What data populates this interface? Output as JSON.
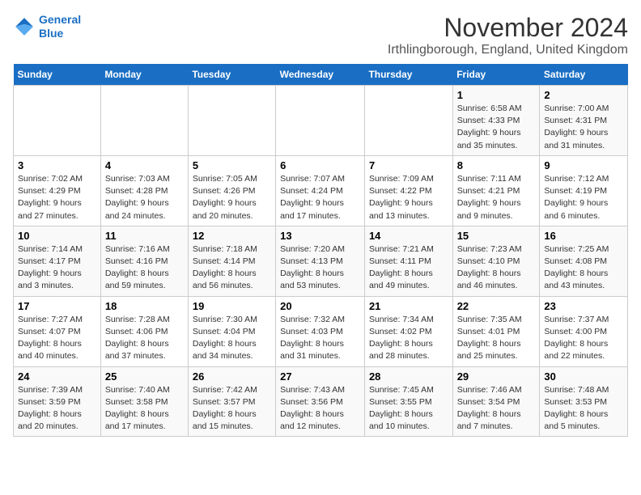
{
  "logo": {
    "line1": "General",
    "line2": "Blue"
  },
  "title": "November 2024",
  "location": "Irthlingborough, England, United Kingdom",
  "days_of_week": [
    "Sunday",
    "Monday",
    "Tuesday",
    "Wednesday",
    "Thursday",
    "Friday",
    "Saturday"
  ],
  "weeks": [
    [
      {
        "day": "",
        "info": ""
      },
      {
        "day": "",
        "info": ""
      },
      {
        "day": "",
        "info": ""
      },
      {
        "day": "",
        "info": ""
      },
      {
        "day": "",
        "info": ""
      },
      {
        "day": "1",
        "info": "Sunrise: 6:58 AM\nSunset: 4:33 PM\nDaylight: 9 hours and 35 minutes."
      },
      {
        "day": "2",
        "info": "Sunrise: 7:00 AM\nSunset: 4:31 PM\nDaylight: 9 hours and 31 minutes."
      }
    ],
    [
      {
        "day": "3",
        "info": "Sunrise: 7:02 AM\nSunset: 4:29 PM\nDaylight: 9 hours and 27 minutes."
      },
      {
        "day": "4",
        "info": "Sunrise: 7:03 AM\nSunset: 4:28 PM\nDaylight: 9 hours and 24 minutes."
      },
      {
        "day": "5",
        "info": "Sunrise: 7:05 AM\nSunset: 4:26 PM\nDaylight: 9 hours and 20 minutes."
      },
      {
        "day": "6",
        "info": "Sunrise: 7:07 AM\nSunset: 4:24 PM\nDaylight: 9 hours and 17 minutes."
      },
      {
        "day": "7",
        "info": "Sunrise: 7:09 AM\nSunset: 4:22 PM\nDaylight: 9 hours and 13 minutes."
      },
      {
        "day": "8",
        "info": "Sunrise: 7:11 AM\nSunset: 4:21 PM\nDaylight: 9 hours and 9 minutes."
      },
      {
        "day": "9",
        "info": "Sunrise: 7:12 AM\nSunset: 4:19 PM\nDaylight: 9 hours and 6 minutes."
      }
    ],
    [
      {
        "day": "10",
        "info": "Sunrise: 7:14 AM\nSunset: 4:17 PM\nDaylight: 9 hours and 3 minutes."
      },
      {
        "day": "11",
        "info": "Sunrise: 7:16 AM\nSunset: 4:16 PM\nDaylight: 8 hours and 59 minutes."
      },
      {
        "day": "12",
        "info": "Sunrise: 7:18 AM\nSunset: 4:14 PM\nDaylight: 8 hours and 56 minutes."
      },
      {
        "day": "13",
        "info": "Sunrise: 7:20 AM\nSunset: 4:13 PM\nDaylight: 8 hours and 53 minutes."
      },
      {
        "day": "14",
        "info": "Sunrise: 7:21 AM\nSunset: 4:11 PM\nDaylight: 8 hours and 49 minutes."
      },
      {
        "day": "15",
        "info": "Sunrise: 7:23 AM\nSunset: 4:10 PM\nDaylight: 8 hours and 46 minutes."
      },
      {
        "day": "16",
        "info": "Sunrise: 7:25 AM\nSunset: 4:08 PM\nDaylight: 8 hours and 43 minutes."
      }
    ],
    [
      {
        "day": "17",
        "info": "Sunrise: 7:27 AM\nSunset: 4:07 PM\nDaylight: 8 hours and 40 minutes."
      },
      {
        "day": "18",
        "info": "Sunrise: 7:28 AM\nSunset: 4:06 PM\nDaylight: 8 hours and 37 minutes."
      },
      {
        "day": "19",
        "info": "Sunrise: 7:30 AM\nSunset: 4:04 PM\nDaylight: 8 hours and 34 minutes."
      },
      {
        "day": "20",
        "info": "Sunrise: 7:32 AM\nSunset: 4:03 PM\nDaylight: 8 hours and 31 minutes."
      },
      {
        "day": "21",
        "info": "Sunrise: 7:34 AM\nSunset: 4:02 PM\nDaylight: 8 hours and 28 minutes."
      },
      {
        "day": "22",
        "info": "Sunrise: 7:35 AM\nSunset: 4:01 PM\nDaylight: 8 hours and 25 minutes."
      },
      {
        "day": "23",
        "info": "Sunrise: 7:37 AM\nSunset: 4:00 PM\nDaylight: 8 hours and 22 minutes."
      }
    ],
    [
      {
        "day": "24",
        "info": "Sunrise: 7:39 AM\nSunset: 3:59 PM\nDaylight: 8 hours and 20 minutes."
      },
      {
        "day": "25",
        "info": "Sunrise: 7:40 AM\nSunset: 3:58 PM\nDaylight: 8 hours and 17 minutes."
      },
      {
        "day": "26",
        "info": "Sunrise: 7:42 AM\nSunset: 3:57 PM\nDaylight: 8 hours and 15 minutes."
      },
      {
        "day": "27",
        "info": "Sunrise: 7:43 AM\nSunset: 3:56 PM\nDaylight: 8 hours and 12 minutes."
      },
      {
        "day": "28",
        "info": "Sunrise: 7:45 AM\nSunset: 3:55 PM\nDaylight: 8 hours and 10 minutes."
      },
      {
        "day": "29",
        "info": "Sunrise: 7:46 AM\nSunset: 3:54 PM\nDaylight: 8 hours and 7 minutes."
      },
      {
        "day": "30",
        "info": "Sunrise: 7:48 AM\nSunset: 3:53 PM\nDaylight: 8 hours and 5 minutes."
      }
    ]
  ]
}
